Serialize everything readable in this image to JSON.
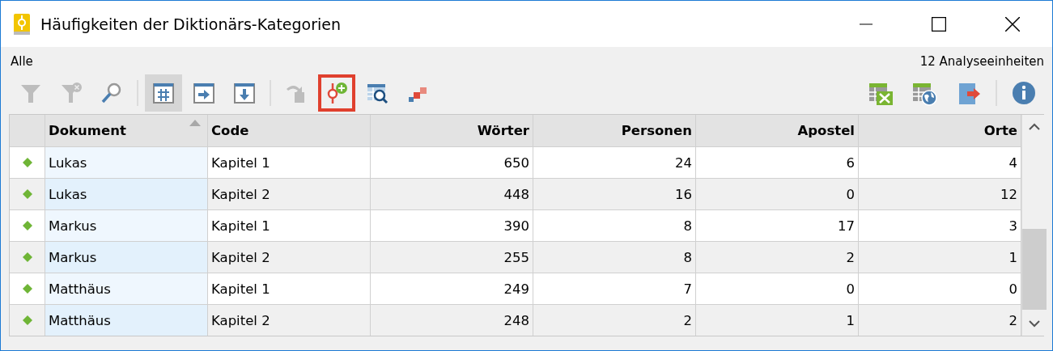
{
  "window": {
    "title": "Häufigkeiten der Diktionärs-Kategorien"
  },
  "filter_label": "Alle",
  "unit_count": "12 Analyseeinheiten",
  "toolbar_left": [
    {
      "kind": "filter",
      "disabled": true,
      "pressed": false,
      "highlighted": false
    },
    {
      "kind": "filter-clear",
      "disabled": true,
      "pressed": false,
      "highlighted": false
    },
    {
      "kind": "search",
      "disabled": false,
      "pressed": false,
      "highlighted": false
    },
    {
      "kind": "sep"
    },
    {
      "kind": "grid-hash",
      "disabled": false,
      "pressed": true,
      "highlighted": false
    },
    {
      "kind": "grid-right",
      "disabled": false,
      "pressed": false,
      "highlighted": false
    },
    {
      "kind": "grid-down",
      "disabled": false,
      "pressed": false,
      "highlighted": false
    },
    {
      "kind": "sep"
    },
    {
      "kind": "redo",
      "disabled": true,
      "pressed": false,
      "highlighted": false
    },
    {
      "kind": "code-add",
      "disabled": false,
      "pressed": false,
      "highlighted": true
    },
    {
      "kind": "table-search",
      "disabled": false,
      "pressed": false,
      "highlighted": false
    },
    {
      "kind": "squares",
      "disabled": false,
      "pressed": false,
      "highlighted": false
    }
  ],
  "toolbar_right": [
    {
      "kind": "excel"
    },
    {
      "kind": "web"
    },
    {
      "kind": "export"
    },
    {
      "kind": "sep"
    },
    {
      "kind": "info"
    }
  ],
  "table": {
    "columns": [
      {
        "label": "Dokument",
        "sorted": true
      },
      {
        "label": "Code",
        "sorted": false
      },
      {
        "label": "Wörter",
        "sorted": false
      },
      {
        "label": "Personen",
        "sorted": false
      },
      {
        "label": "Apostel",
        "sorted": false
      },
      {
        "label": "Orte",
        "sorted": false
      }
    ],
    "rows": [
      {
        "cells": [
          "Lukas",
          "Kapitel 1",
          "650",
          "24",
          "6",
          "4"
        ]
      },
      {
        "cells": [
          "Lukas",
          "Kapitel 2",
          "448",
          "16",
          "0",
          "12"
        ]
      },
      {
        "cells": [
          "Markus",
          "Kapitel 1",
          "390",
          "8",
          "17",
          "3"
        ]
      },
      {
        "cells": [
          "Markus",
          "Kapitel 2",
          "255",
          "8",
          "2",
          "1"
        ]
      },
      {
        "cells": [
          "Matthäus",
          "Kapitel 1",
          "249",
          "7",
          "0",
          "0"
        ]
      },
      {
        "cells": [
          "Matthäus",
          "Kapitel 2",
          "248",
          "2",
          "1",
          "2"
        ]
      }
    ]
  }
}
